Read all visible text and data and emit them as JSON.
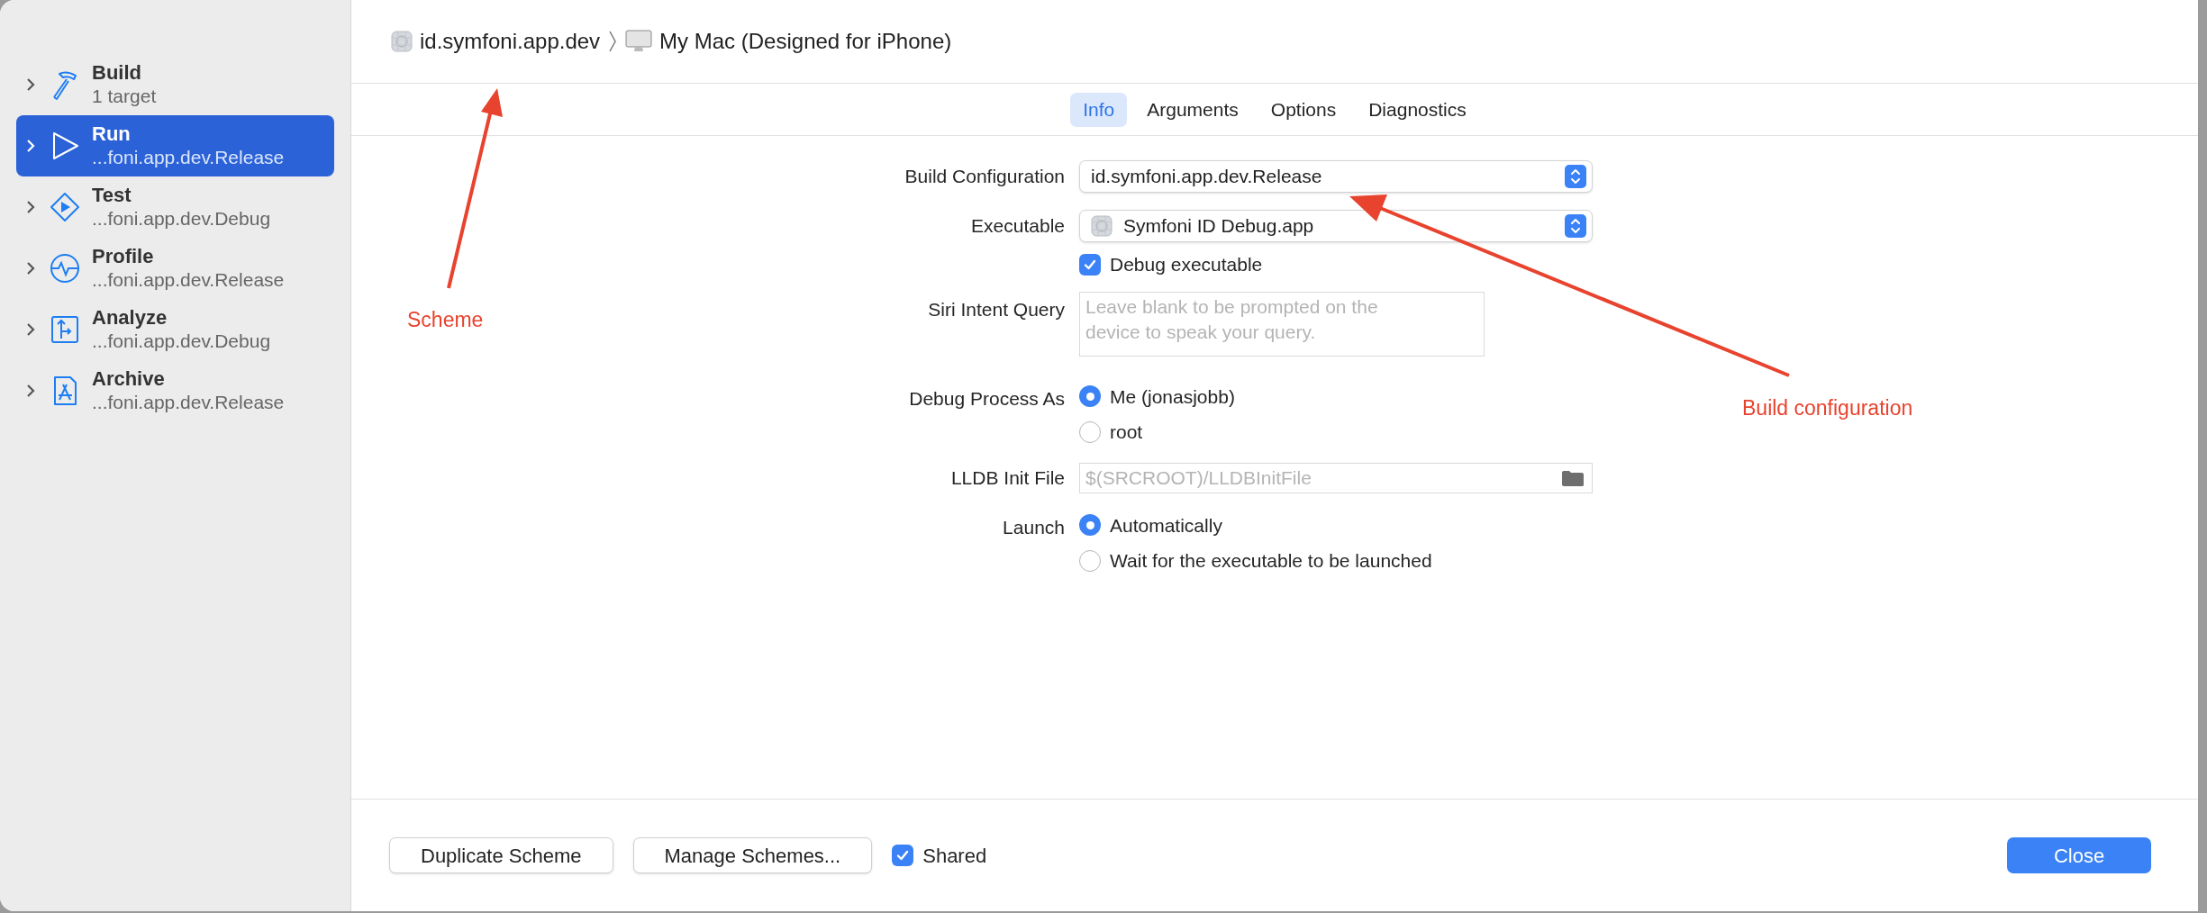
{
  "sidebar": {
    "items": [
      {
        "kind": "build",
        "name": "Build",
        "subtitle": "1 target",
        "selected": false
      },
      {
        "kind": "run",
        "name": "Run",
        "subtitle": "...foni.app.dev.Release",
        "selected": true
      },
      {
        "kind": "test",
        "name": "Test",
        "subtitle": "...foni.app.dev.Debug",
        "selected": false
      },
      {
        "kind": "profile",
        "name": "Profile",
        "subtitle": "...foni.app.dev.Release",
        "selected": false
      },
      {
        "kind": "analyze",
        "name": "Analyze",
        "subtitle": "...foni.app.dev.Debug",
        "selected": false
      },
      {
        "kind": "archive",
        "name": "Archive",
        "subtitle": "...foni.app.dev.Release",
        "selected": false
      }
    ]
  },
  "breadcrumb": {
    "scheme": "id.symfoni.app.dev",
    "destination": "My Mac (Designed for iPhone)"
  },
  "tabs": [
    {
      "label": "Info",
      "selected": true
    },
    {
      "label": "Arguments",
      "selected": false
    },
    {
      "label": "Options",
      "selected": false
    },
    {
      "label": "Diagnostics",
      "selected": false
    }
  ],
  "form": [
    {
      "kind": "popup",
      "label": "Build Configuration",
      "value": "id.symfoni.app.dev.Release",
      "has_icon": false
    },
    {
      "kind": "popup",
      "label": "Executable",
      "value": "Symfoni ID Debug.app",
      "has_icon": true
    },
    {
      "kind": "checkbox",
      "label": "Debug executable",
      "checked": true
    },
    {
      "kind": "textarea",
      "label": "Siri Intent Query",
      "placeholder": "Leave blank to be prompted on the device to speak your query."
    },
    {
      "kind": "radio",
      "label": "Debug Process As",
      "options": [
        {
          "label": "Me (jonasjobb)",
          "selected": true
        },
        {
          "label": "root",
          "selected": false
        }
      ]
    },
    {
      "kind": "file",
      "label": "LLDB Init File",
      "placeholder": "$(SRCROOT)/LLDBInitFile"
    },
    {
      "kind": "radio",
      "label": "Launch",
      "options": [
        {
          "label": "Automatically",
          "selected": true
        },
        {
          "label": "Wait for the executable to be launched",
          "selected": false
        }
      ]
    }
  ],
  "footer": {
    "buttons": [
      "Duplicate Scheme",
      "Manage Schemes..."
    ],
    "shared": {
      "label": "Shared",
      "checked": true
    },
    "close": "Close"
  },
  "annotations": [
    {
      "kind": "scheme",
      "text": "Scheme"
    },
    {
      "kind": "build_configuration",
      "text": "Build configuration"
    }
  ]
}
